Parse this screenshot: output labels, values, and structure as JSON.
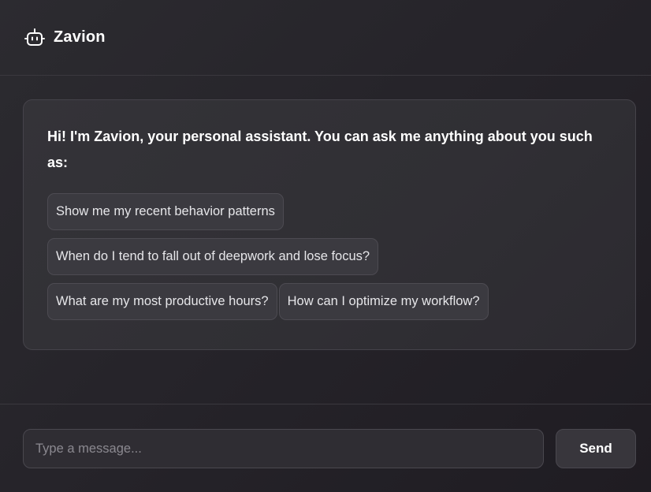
{
  "header": {
    "title": "Zavion",
    "icon": "robot-icon"
  },
  "intro": {
    "message": "Hi! I'm Zavion, your personal assistant. You can ask me anything about you such as:"
  },
  "suggestions": [
    [
      "Show me my recent behavior patterns"
    ],
    [
      "When do I tend to fall out of deepwork and lose focus?"
    ],
    [
      "What are my most productive hours?",
      "How can I optimize my workflow?"
    ]
  ],
  "composer": {
    "placeholder": "Type a message...",
    "value": "",
    "send_label": "Send"
  },
  "colors": {
    "background": "#26242a",
    "card": "#323136",
    "chip": "#3b3a40",
    "border": "#45434a",
    "text": "#ffffff"
  }
}
